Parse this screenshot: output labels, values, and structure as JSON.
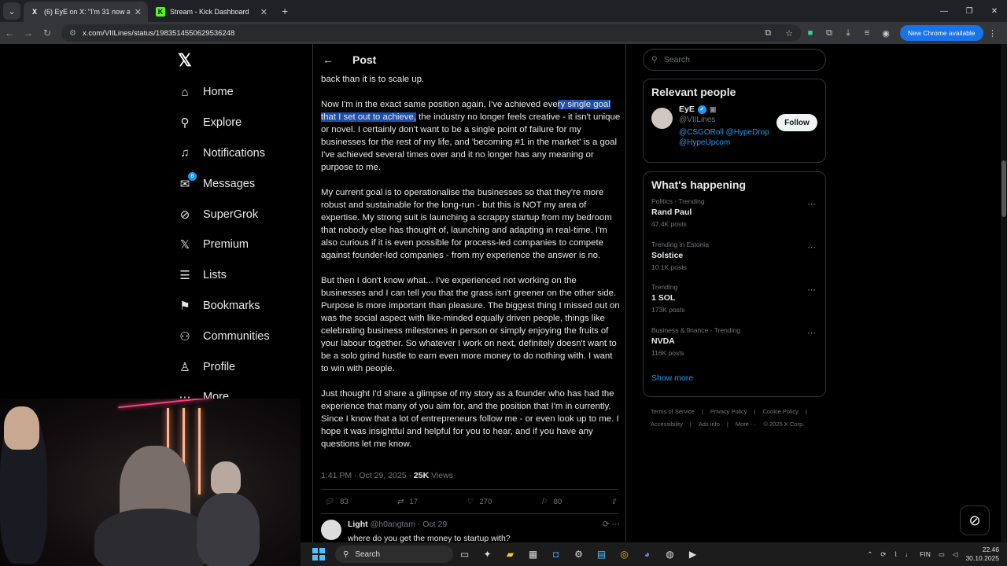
{
  "browser": {
    "tabs": [
      {
        "title": "(6) EyE on X: \"I'm 31 now and I'",
        "active": true,
        "favicon": "X"
      },
      {
        "title": "Stream - Kick Dashboard",
        "active": false,
        "favicon": "K"
      }
    ],
    "url": "x.com/VIILines/status/1983514550629536248",
    "new_chrome_label": "New Chrome available"
  },
  "nav": {
    "items": [
      {
        "label": "Home",
        "icon": "home-icon"
      },
      {
        "label": "Explore",
        "icon": "search-icon"
      },
      {
        "label": "Notifications",
        "icon": "bell-icon"
      },
      {
        "label": "Messages",
        "icon": "mail-icon",
        "badge": "6"
      },
      {
        "label": "SuperGrok",
        "icon": "grok-icon"
      },
      {
        "label": "Premium",
        "icon": "x-icon"
      },
      {
        "label": "Lists",
        "icon": "list-icon"
      },
      {
        "label": "Bookmarks",
        "icon": "bookmark-icon"
      },
      {
        "label": "Communities",
        "icon": "people-icon"
      },
      {
        "label": "Profile",
        "icon": "person-icon"
      },
      {
        "label": "More",
        "icon": "more-icon"
      }
    ]
  },
  "post": {
    "header": "Post",
    "p0": "back than it is to scale up.",
    "p1_pre": "Now I'm in the exact same position again, I've achieved eve",
    "p1_hl": "ry single goal that I set out to achieve,",
    "p1_post": " the industry no longer feels creative - it isn't unique or novel. I certainly don't want to be a single point of failure for my businesses for the rest of my life, and 'becoming #1 in the market' is a goal I've achieved several times over and it no longer has any meaning or purpose to me.",
    "p2": "My current goal is to operationalise the businesses so that they're more robust and sustainable for the long-run - but this is NOT my area of expertise.  My strong suit is launching a scrappy startup from my bedroom that nobody else has thought of, launching and adapting in real-time. I'm also curious if it is even possible for process-led companies to compete against founder-led companies - from my experience the answer is no.",
    "p3": "But then I don't know what... I've experienced not working on the businesses and I can tell you that the grass isn't greener on the other side. Purpose is more important than pleasure. The biggest thing I missed out on was the social aspect with like-minded equally driven people, things like celebrating business milestones in person or simply enjoying the fruits of your labour together. So whatever I work on next, definitely doesn't want to be a solo grind hustle to earn even more money to do nothing with. I want to win with people.",
    "p4": "Just thought I'd share a glimpse of my story as a founder who has had the experience that many of you aim for, and the position that I'm in currently. Since I know that a lot of entrepreneurs follow me - or even look up to me. I hope it was insightful and helpful for you to hear, and if you have any questions let me know.",
    "time": "1:41 PM · Oct 29, 2025 · ",
    "views_count": "25K",
    "views_label": " Views",
    "replies": "83",
    "reposts": "17",
    "likes": "270",
    "bookmarks": "80"
  },
  "reply": {
    "name": "Light",
    "handle": "@h0angtam · Oct 29",
    "text": "where do you get the money to startup with?"
  },
  "sidebar": {
    "search_placeholder": "Search",
    "relevant_title": "Relevant people",
    "person_name": "EyE",
    "person_handle": "@VIILines",
    "person_bio": "@CSGORoll @HypeDrop @HypeUpcom",
    "follow_label": "Follow",
    "happening_title": "What's happening",
    "trends": [
      {
        "category": "Politics · Trending",
        "name": "Rand Paul",
        "count": "47.4K posts"
      },
      {
        "category": "Trending in Estonia",
        "name": "Solstice",
        "count": "10.1K posts"
      },
      {
        "category": "Trending",
        "name": "1 SOL",
        "count": "173K posts"
      },
      {
        "category": "Business & finance · Trending",
        "name": "NVDA",
        "count": "116K posts"
      }
    ],
    "show_more": "Show more",
    "footer": [
      "Terms of Service",
      "|",
      "Privacy Policy",
      "|",
      "Cookie Policy",
      "|",
      "Accessibility",
      "|",
      "Ads info",
      "|",
      "More ···",
      "© 2025 X Corp."
    ]
  },
  "taskbar": {
    "search": "Search",
    "lang": "FIN",
    "time": "22.46",
    "date": "30.10.2025"
  }
}
